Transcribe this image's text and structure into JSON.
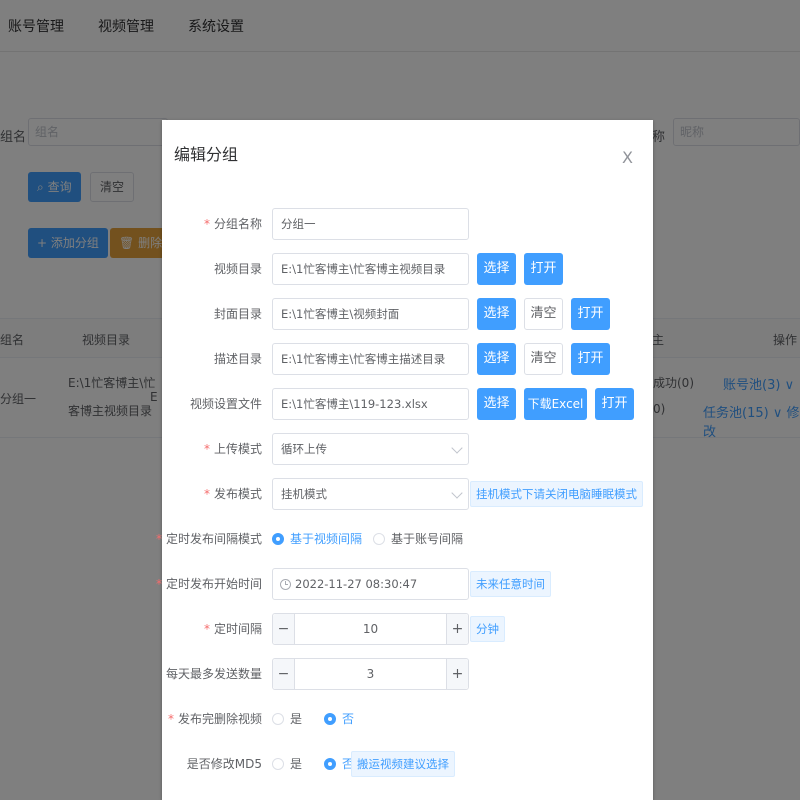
{
  "nav": {
    "items": [
      {
        "label": "账号管理"
      },
      {
        "label": "视频管理"
      },
      {
        "label": "系统设置"
      }
    ]
  },
  "filters": {
    "group_label": "组名",
    "group_placeholder": "组名",
    "nickname_label": "称",
    "nickname_placeholder": "昵称",
    "query_label": "查询",
    "clear_label": "清空",
    "add_label": "添加分组",
    "delete_label": "删除分"
  },
  "table": {
    "headers": [
      "组名",
      "视频目录",
      "主",
      "操作"
    ],
    "row": {
      "name": "分组一",
      "dir_line1": "E:\\1忙客博主\\忙",
      "dir_line2": "客博主视频目录",
      "ext": "E",
      "status1": "成功(0)",
      "status2": "0)",
      "account_pool": "账号池(3)",
      "task_pool": "任务池(15)",
      "edit": "修改"
    }
  },
  "dialog": {
    "title": "编辑分组",
    "close": "X",
    "fields": {
      "group_name": {
        "label": "分组名称",
        "value": "分组一"
      },
      "video_dir": {
        "label": "视频目录",
        "value": "E:\\1忙客博主\\忙客博主视频目录"
      },
      "cover_dir": {
        "label": "封面目录",
        "value": "E:\\1忙客博主\\视频封面"
      },
      "desc_dir": {
        "label": "描述目录",
        "value": "E:\\1忙客博主\\忙客博主描述目录"
      },
      "video_file": {
        "label": "视频设置文件",
        "value": "E:\\1忙客博主\\119-123.xlsx"
      },
      "upload_mode": {
        "label": "上传模式",
        "value": "循环上传"
      },
      "publish_mode": {
        "label": "发布模式",
        "value": "挂机模式",
        "hint": "挂机模式下请关闭电脑睡眠模式"
      },
      "interval_mode": {
        "label": "定时发布间隔模式",
        "option1": "基于视频间隔",
        "option2": "基于账号间隔"
      },
      "start_time": {
        "label": "定时发布开始时间",
        "value": "2022-11-27 08:30:47",
        "hint": "未来任意时间"
      },
      "interval": {
        "label": "定时间隔",
        "value": "10",
        "unit": "分钟"
      },
      "daily_max": {
        "label": "每天最多发送数量",
        "value": "3"
      },
      "delete_after": {
        "label": "发布完删除视频",
        "yes": "是",
        "no": "否"
      },
      "modify_md5": {
        "label": "是否修改MD5",
        "yes": "是",
        "no": "否",
        "hint": "搬运视频建议选择"
      }
    },
    "buttons": {
      "select": "选择",
      "open": "打开",
      "clear": "清空",
      "download_excel": "下载Excel"
    },
    "stepper": {
      "minus": "−",
      "plus": "+"
    }
  }
}
